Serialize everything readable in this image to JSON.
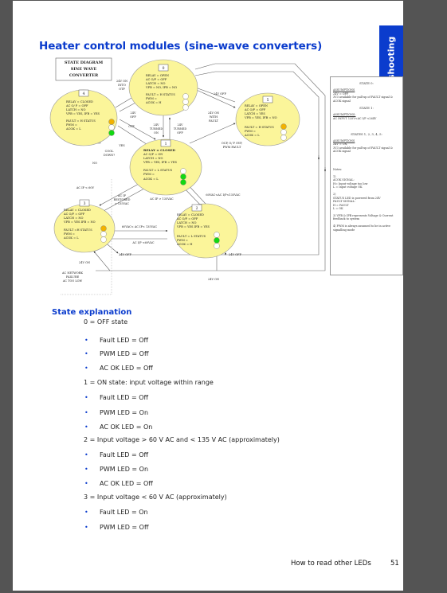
{
  "sidebar_tab": {
    "label": "Troubleshooting",
    "color": "#0b3ccd"
  },
  "title": "Heater control modules (sine-wave converters)",
  "diagram": {
    "label_box": [
      "STATE DIAGRAM",
      "SINE WAVE",
      "CONVERTER"
    ],
    "states": [
      {
        "id": "0",
        "lines": [
          "RELAY = OPEN",
          "AC O/P = OFF",
          "LATCH = NO",
          "VFB = NO, IFB = NO"
        ],
        "status": [
          "FAULT = H  STATUS",
          "PWM =",
          "ACOK = H"
        ],
        "leds": [
          "off",
          "off",
          "off"
        ]
      },
      {
        "id": "1",
        "lines": [
          "RELAY = CLOSED",
          "AC O/P = ON",
          "LATCH = NO",
          "VFB = YES, IFB = YES"
        ],
        "status": [
          "FAULT = L   STATUS",
          "PWM =",
          "ACOK = L"
        ],
        "leds": [
          "off",
          "green",
          "green"
        ]
      },
      {
        "id": "2",
        "lines": [
          "RELAY = CLOSED",
          "AC O/P = OFF",
          "LATCH = NO",
          "VFB = YES   IFB = YES"
        ],
        "status": [
          "FAULT = L     STATUS",
          "PWM =",
          "ACOK  = H"
        ],
        "leds": [
          "off",
          "green",
          "off"
        ]
      },
      {
        "id": "3",
        "lines": [
          "RELAY = CLOSED",
          "AC O/P = OFF",
          "LATCH  = NO",
          "VFB = YES   IFB = NO"
        ],
        "status": [
          "FAULT =H   STATUS",
          "PWM =",
          "ACOK = L"
        ],
        "leds": [
          "orange",
          "off",
          "off"
        ]
      },
      {
        "id": "4",
        "lines": [
          "RELAY = CLOSED",
          "AC O/ P = OFF",
          "LATCH = NO",
          "VFB = YES, IFB = YES"
        ],
        "status": [
          "FAULT = H  STATUS",
          "PWM =",
          "ACOK = L"
        ],
        "leds": [
          "orange",
          "off",
          "green"
        ]
      },
      {
        "id": "5",
        "lines": [
          "RELAY = OPEN",
          "AC O/P = OFF",
          "LATCH  = YES",
          "VFB = YES, IFB = NO"
        ],
        "status": [
          "FAULT = H    STATUS",
          "PWM =",
          "ACOK = L"
        ],
        "leds": [
          "orange",
          "off",
          "off"
        ]
      }
    ],
    "transitions": {
      "on_into_otp": [
        "24V ON",
        "INTO",
        "OTP"
      ],
      "off_4": [
        "24V",
        "OFF"
      ],
      "otp": "OTP",
      "turned_on": [
        "24V",
        "TURNED",
        "ON"
      ],
      "turned_off": [
        "24V",
        "TURNED",
        "OFF"
      ],
      "off_top": "24V OFF",
      "on_fault": [
        "24V ON",
        "WITH",
        "FAULT"
      ],
      "ocp": [
        "OCP, O/ P OVP,",
        "PWM FAULT"
      ],
      "yes": "YES",
      "cool_down": [
        "COOL",
        "DOWN?"
      ],
      "no": "NO",
      "ac_lt_60": "AC IP < 60V",
      "restored": [
        "AC IP",
        "RESTORED",
        "> 135VAC"
      ],
      "ac_gt_135": "AC IP > 135VAC",
      "range_60_135": "60VAC<AC I/P<135VAC",
      "range_60_135_b": "60VAC< AC IP< 135VAC",
      "ac_lt_60_b": "AC I/P <60VAC",
      "off_3": "24V OFF",
      "off_2": "24V OFF",
      "on_3": "24V ON",
      "on_bottom": "24V ON",
      "network": [
        "AC NETWORK",
        "FAILURE",
        "AC TOO LOW"
      ]
    }
  },
  "assumptions": {
    "state0_title": "STATE 0:",
    "state0_head": "ASSUMPTIONS",
    "state0_text": [
      "24V = OFF",
      "3V3 available for pull-up of FAULT signal & ACOK signal"
    ],
    "state1_title": "STATE 1:",
    "state1_head": "ASSUMPTIONS:",
    "state1_text": "AC INPUT 135V<AC I/P <264V",
    "states_title": "STATES 1, 2, 3, 4, 5:",
    "states_head": "ASSUMPTIONS",
    "states_text": [
      "24V = ON,",
      "3V3 available for pull-up of FAULT signal & ACOK signal"
    ],
    "notes_head": "Notes:",
    "notes": [
      [
        "1)",
        "ACOK SIGNAL:",
        "H= Input voltage too low",
        "L = Input voltage OK"
      ],
      [
        "2)",
        "STATUS LED is powered from 24V",
        "FAULT SIGNAL:",
        "H = FAULT",
        "L = OK"
      ],
      [
        "3) VFB & IFB represents Voltage & Current feedback to system"
      ],
      [
        "4) PWM is always assumed to be in active signalling mode"
      ]
    ]
  },
  "section_heading": "State explanation",
  "states_text": [
    {
      "heading": "0 = OFF state",
      "items": [
        "Fault LED = Off",
        "PWM LED = Off",
        "AC OK LED = Off"
      ]
    },
    {
      "heading": "1 = ON state: input voltage within range",
      "items": [
        "Fault LED = Off",
        "PWM LED = On",
        "AC OK LED = On"
      ]
    },
    {
      "heading": "2 = Input voltage > 60 V AC and < 135 V AC (approximately)",
      "items": [
        "Fault LED = Off",
        "PWM LED = On",
        "AC OK LED = Off"
      ]
    },
    {
      "heading": "3 = Input voltage < 60 V AC (approximately)",
      "items": [
        "Fault LED = On",
        "PWM LED = Off"
      ]
    }
  ],
  "bullet_char": "•",
  "footer": {
    "section": "How to read other LEDs",
    "page": "51"
  },
  "colors": {
    "state_fill": "#fbf59a",
    "led_orange": "#f2b200",
    "led_green": "#12d812",
    "accent": "#0b3ccd"
  }
}
